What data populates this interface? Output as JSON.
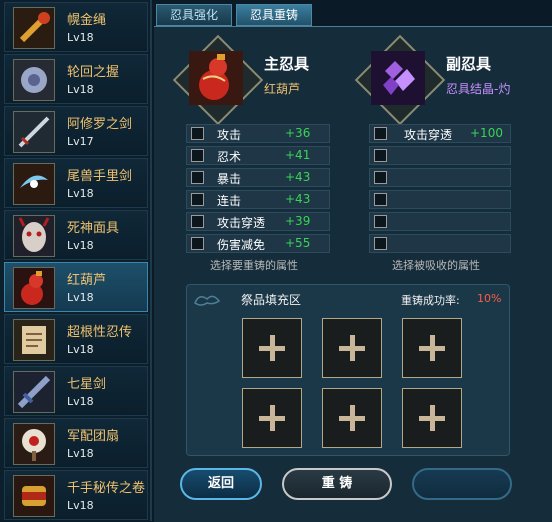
{
  "sidebar": {
    "items": [
      {
        "name": "幌金绳",
        "level": "Lv18",
        "icon": "rope-icon"
      },
      {
        "name": "轮回之握",
        "level": "Lv18",
        "icon": "orb-icon"
      },
      {
        "name": "阿修罗之剑",
        "level": "Lv17",
        "icon": "sword-icon"
      },
      {
        "name": "尾兽手里剑",
        "level": "Lv18",
        "icon": "shuriken-icon"
      },
      {
        "name": "死神面具",
        "level": "Lv18",
        "icon": "mask-icon"
      },
      {
        "name": "红葫芦",
        "level": "Lv18",
        "icon": "gourd-icon"
      },
      {
        "name": "超根性忍传",
        "level": "Lv18",
        "icon": "book-icon"
      },
      {
        "name": "七星剑",
        "level": "Lv18",
        "icon": "seven-star-sword-icon"
      },
      {
        "name": "军配团扇",
        "level": "Lv18",
        "icon": "fan-icon"
      },
      {
        "name": "千手秘传之卷",
        "level": "Lv18",
        "icon": "scroll-icon"
      }
    ],
    "selected_index": 5
  },
  "tabs": [
    {
      "label": "忍具强化"
    },
    {
      "label": "忍具重铸",
      "active": true
    }
  ],
  "main_tool": {
    "title": "主忍具",
    "name": "红葫芦",
    "icon": "red-gourd-icon",
    "attributes": [
      {
        "name": "攻击",
        "value": "+36"
      },
      {
        "name": "忍术",
        "value": "+41"
      },
      {
        "name": "暴击",
        "value": "+43"
      },
      {
        "name": "连击",
        "value": "+43"
      },
      {
        "name": "攻击穿透",
        "value": "+39"
      },
      {
        "name": "伤害减免",
        "value": "+55"
      }
    ],
    "hint": "选择要重铸的属性"
  },
  "sub_tool": {
    "title": "副忍具",
    "name": "忍具结晶-灼",
    "icon": "purple-crystal-icon",
    "attributes": [
      {
        "name": "攻击穿透",
        "value": "+100"
      },
      {
        "name": "",
        "value": ""
      },
      {
        "name": "",
        "value": ""
      },
      {
        "name": "",
        "value": ""
      },
      {
        "name": "",
        "value": ""
      },
      {
        "name": "",
        "value": ""
      }
    ],
    "hint": "选择被吸收的属性"
  },
  "offering": {
    "title": "祭品填充区",
    "success_label": "重铸成功率:",
    "success_rate": "10%"
  },
  "buttons": {
    "back": "返回",
    "recast": "重 铸"
  },
  "colors": {
    "accent": "#5ab7e6",
    "gold": "#f0c270",
    "value_green": "#39d455",
    "crystal_purple": "#c690ff",
    "rate_red": "#ff5a4a"
  }
}
